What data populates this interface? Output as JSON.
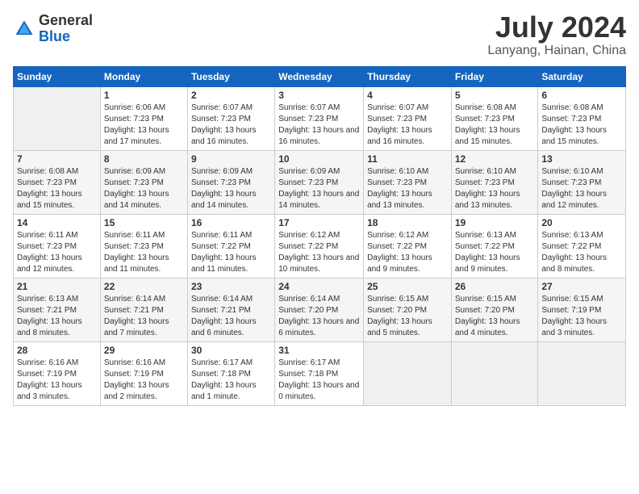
{
  "logo": {
    "general": "General",
    "blue": "Blue"
  },
  "title": {
    "month_year": "July 2024",
    "location": "Lanyang, Hainan, China"
  },
  "weekdays": [
    "Sunday",
    "Monday",
    "Tuesday",
    "Wednesday",
    "Thursday",
    "Friday",
    "Saturday"
  ],
  "weeks": [
    [
      {
        "day": "",
        "sunrise": "",
        "sunset": "",
        "daylight": ""
      },
      {
        "day": "1",
        "sunrise": "Sunrise: 6:06 AM",
        "sunset": "Sunset: 7:23 PM",
        "daylight": "Daylight: 13 hours and 17 minutes."
      },
      {
        "day": "2",
        "sunrise": "Sunrise: 6:07 AM",
        "sunset": "Sunset: 7:23 PM",
        "daylight": "Daylight: 13 hours and 16 minutes."
      },
      {
        "day": "3",
        "sunrise": "Sunrise: 6:07 AM",
        "sunset": "Sunset: 7:23 PM",
        "daylight": "Daylight: 13 hours and 16 minutes."
      },
      {
        "day": "4",
        "sunrise": "Sunrise: 6:07 AM",
        "sunset": "Sunset: 7:23 PM",
        "daylight": "Daylight: 13 hours and 16 minutes."
      },
      {
        "day": "5",
        "sunrise": "Sunrise: 6:08 AM",
        "sunset": "Sunset: 7:23 PM",
        "daylight": "Daylight: 13 hours and 15 minutes."
      },
      {
        "day": "6",
        "sunrise": "Sunrise: 6:08 AM",
        "sunset": "Sunset: 7:23 PM",
        "daylight": "Daylight: 13 hours and 15 minutes."
      }
    ],
    [
      {
        "day": "7",
        "sunrise": "Sunrise: 6:08 AM",
        "sunset": "Sunset: 7:23 PM",
        "daylight": "Daylight: 13 hours and 15 minutes."
      },
      {
        "day": "8",
        "sunrise": "Sunrise: 6:09 AM",
        "sunset": "Sunset: 7:23 PM",
        "daylight": "Daylight: 13 hours and 14 minutes."
      },
      {
        "day": "9",
        "sunrise": "Sunrise: 6:09 AM",
        "sunset": "Sunset: 7:23 PM",
        "daylight": "Daylight: 13 hours and 14 minutes."
      },
      {
        "day": "10",
        "sunrise": "Sunrise: 6:09 AM",
        "sunset": "Sunset: 7:23 PM",
        "daylight": "Daylight: 13 hours and 14 minutes."
      },
      {
        "day": "11",
        "sunrise": "Sunrise: 6:10 AM",
        "sunset": "Sunset: 7:23 PM",
        "daylight": "Daylight: 13 hours and 13 minutes."
      },
      {
        "day": "12",
        "sunrise": "Sunrise: 6:10 AM",
        "sunset": "Sunset: 7:23 PM",
        "daylight": "Daylight: 13 hours and 13 minutes."
      },
      {
        "day": "13",
        "sunrise": "Sunrise: 6:10 AM",
        "sunset": "Sunset: 7:23 PM",
        "daylight": "Daylight: 13 hours and 12 minutes."
      }
    ],
    [
      {
        "day": "14",
        "sunrise": "Sunrise: 6:11 AM",
        "sunset": "Sunset: 7:23 PM",
        "daylight": "Daylight: 13 hours and 12 minutes."
      },
      {
        "day": "15",
        "sunrise": "Sunrise: 6:11 AM",
        "sunset": "Sunset: 7:23 PM",
        "daylight": "Daylight: 13 hours and 11 minutes."
      },
      {
        "day": "16",
        "sunrise": "Sunrise: 6:11 AM",
        "sunset": "Sunset: 7:22 PM",
        "daylight": "Daylight: 13 hours and 11 minutes."
      },
      {
        "day": "17",
        "sunrise": "Sunrise: 6:12 AM",
        "sunset": "Sunset: 7:22 PM",
        "daylight": "Daylight: 13 hours and 10 minutes."
      },
      {
        "day": "18",
        "sunrise": "Sunrise: 6:12 AM",
        "sunset": "Sunset: 7:22 PM",
        "daylight": "Daylight: 13 hours and 9 minutes."
      },
      {
        "day": "19",
        "sunrise": "Sunrise: 6:13 AM",
        "sunset": "Sunset: 7:22 PM",
        "daylight": "Daylight: 13 hours and 9 minutes."
      },
      {
        "day": "20",
        "sunrise": "Sunrise: 6:13 AM",
        "sunset": "Sunset: 7:22 PM",
        "daylight": "Daylight: 13 hours and 8 minutes."
      }
    ],
    [
      {
        "day": "21",
        "sunrise": "Sunrise: 6:13 AM",
        "sunset": "Sunset: 7:21 PM",
        "daylight": "Daylight: 13 hours and 8 minutes."
      },
      {
        "day": "22",
        "sunrise": "Sunrise: 6:14 AM",
        "sunset": "Sunset: 7:21 PM",
        "daylight": "Daylight: 13 hours and 7 minutes."
      },
      {
        "day": "23",
        "sunrise": "Sunrise: 6:14 AM",
        "sunset": "Sunset: 7:21 PM",
        "daylight": "Daylight: 13 hours and 6 minutes."
      },
      {
        "day": "24",
        "sunrise": "Sunrise: 6:14 AM",
        "sunset": "Sunset: 7:20 PM",
        "daylight": "Daylight: 13 hours and 6 minutes."
      },
      {
        "day": "25",
        "sunrise": "Sunrise: 6:15 AM",
        "sunset": "Sunset: 7:20 PM",
        "daylight": "Daylight: 13 hours and 5 minutes."
      },
      {
        "day": "26",
        "sunrise": "Sunrise: 6:15 AM",
        "sunset": "Sunset: 7:20 PM",
        "daylight": "Daylight: 13 hours and 4 minutes."
      },
      {
        "day": "27",
        "sunrise": "Sunrise: 6:15 AM",
        "sunset": "Sunset: 7:19 PM",
        "daylight": "Daylight: 13 hours and 3 minutes."
      }
    ],
    [
      {
        "day": "28",
        "sunrise": "Sunrise: 6:16 AM",
        "sunset": "Sunset: 7:19 PM",
        "daylight": "Daylight: 13 hours and 3 minutes."
      },
      {
        "day": "29",
        "sunrise": "Sunrise: 6:16 AM",
        "sunset": "Sunset: 7:19 PM",
        "daylight": "Daylight: 13 hours and 2 minutes."
      },
      {
        "day": "30",
        "sunrise": "Sunrise: 6:17 AM",
        "sunset": "Sunset: 7:18 PM",
        "daylight": "Daylight: 13 hours and 1 minute."
      },
      {
        "day": "31",
        "sunrise": "Sunrise: 6:17 AM",
        "sunset": "Sunset: 7:18 PM",
        "daylight": "Daylight: 13 hours and 0 minutes."
      },
      {
        "day": "",
        "sunrise": "",
        "sunset": "",
        "daylight": ""
      },
      {
        "day": "",
        "sunrise": "",
        "sunset": "",
        "daylight": ""
      },
      {
        "day": "",
        "sunrise": "",
        "sunset": "",
        "daylight": ""
      }
    ]
  ]
}
